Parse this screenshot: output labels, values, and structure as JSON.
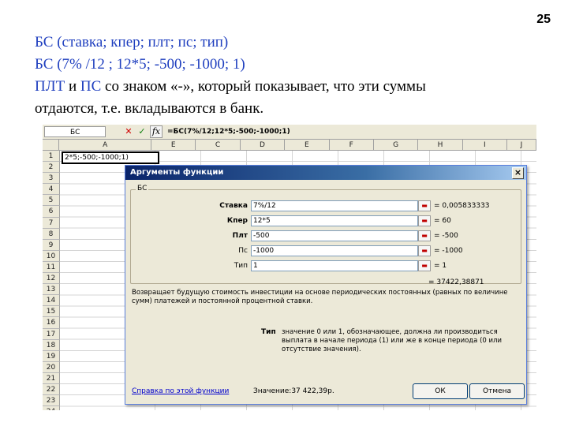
{
  "slide_number": "25",
  "text": {
    "line1": "БС (ставка; кпер; плт; пс; тип)",
    "line2": "БС (7% /12 ; 12*5; -500; -1000; 1)",
    "line3_blue1": "ПЛТ",
    "line3_and": " и ",
    "line3_blue2": "ПС",
    "line3_rest": " со знаком «-», который показывает, что эти суммы",
    "line4": "отдаются, т.е. вкладываются в банк."
  },
  "sheet": {
    "name_box": "БС",
    "cancel_icon": "✕",
    "enter_icon": "✓",
    "fx_icon": "fx",
    "formula": "=БС(7%/12;12*5;-500;-1000;1)",
    "col_headers": [
      "A",
      "E",
      "C",
      "D",
      "E",
      "F",
      "G",
      "H",
      "I",
      "J"
    ],
    "rows": [
      "1",
      "2",
      "3",
      "4",
      "5",
      "6",
      "7",
      "8",
      "9",
      "10",
      "11",
      "12",
      "13",
      "14",
      "15",
      "16",
      "17",
      "18",
      "19",
      "20",
      "21",
      "22",
      "23",
      "24"
    ],
    "cell_a1": "2*5;-500;-1000;1)"
  },
  "dialog": {
    "title": "Аргументы функции",
    "close": "×",
    "group_label": "БС",
    "args": [
      {
        "label": "Ставка",
        "value": "7%/12",
        "result": "= 0,005833333"
      },
      {
        "label": "Кпер",
        "value": "12*5",
        "result": "= 60"
      },
      {
        "label": "Плт",
        "value": "-500",
        "result": "= -500"
      },
      {
        "label": "Пс",
        "value": "-1000",
        "result": "= -1000"
      },
      {
        "label": "Тип",
        "value": "1",
        "result": "= 1"
      }
    ],
    "pick_icon": "▬",
    "total": "= 37422,38871",
    "description": "Возвращает будущую стоимость инвестиции на основе периодических постоянных (равных по величине сумм) платежей и постоянной процентной ставки.",
    "arg_desc_label": "Тип",
    "arg_desc": "значение 0 или 1, обозначающее, должна ли производиться выплата в начале периода (1) или же в конце периода (0 или отсутствие значения).",
    "help_link": "Справка по этой функции",
    "value_text": "Значение:37 422,39р.",
    "ok": "ОК",
    "cancel": "Отмена"
  }
}
